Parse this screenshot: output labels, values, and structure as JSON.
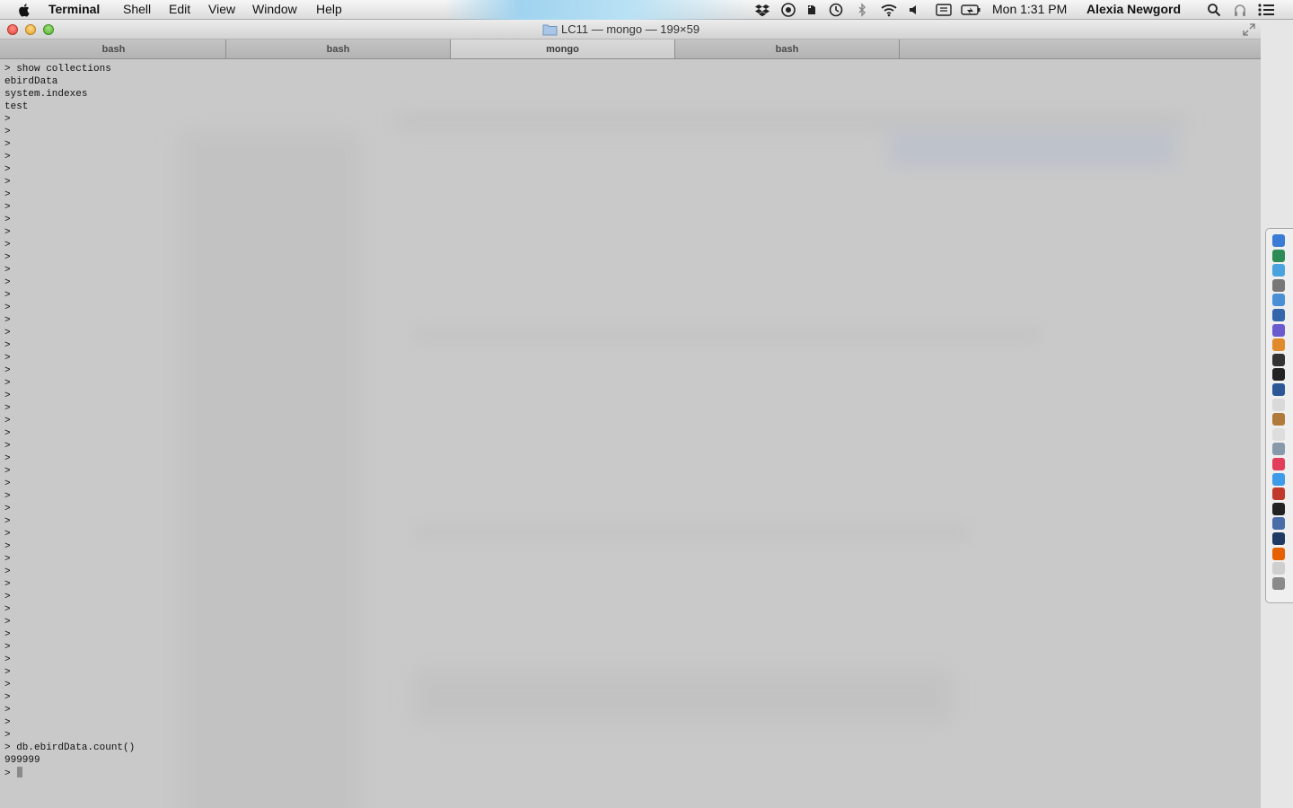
{
  "menubar": {
    "app_name": "Terminal",
    "items": [
      "Shell",
      "Edit",
      "View",
      "Window",
      "Help"
    ],
    "clock": "Mon 1:31 PM",
    "user": "Alexia Newgord",
    "status_icons": [
      "dropbox-icon",
      "sync-icon",
      "evernote-icon",
      "time-machine-icon",
      "bluetooth-icon",
      "wifi-icon",
      "volume-icon",
      "input-menu-icon",
      "battery-icon",
      "spotlight-icon",
      "notification-center-icon"
    ]
  },
  "window": {
    "title": "LC11 — mongo — 199×59",
    "tabs": [
      {
        "label": "bash",
        "active": false
      },
      {
        "label": "bash",
        "active": false
      },
      {
        "label": "mongo",
        "active": true
      },
      {
        "label": "bash",
        "active": false
      }
    ]
  },
  "terminal": {
    "lines": [
      "> show collections",
      "ebirdData",
      "system.indexes",
      "test",
      ">",
      ">",
      ">",
      ">",
      ">",
      ">",
      ">",
      ">",
      ">",
      ">",
      ">",
      ">",
      ">",
      ">",
      ">",
      ">",
      ">",
      ">",
      ">",
      ">",
      ">",
      ">",
      ">",
      ">",
      ">",
      ">",
      ">",
      ">",
      ">",
      ">",
      ">",
      ">",
      ">",
      ">",
      ">",
      ">",
      ">",
      ">",
      ">",
      ">",
      ">",
      ">",
      ">",
      ">",
      ">",
      ">",
      ">",
      ">",
      ">",
      ">",
      "> db.ebirdData.count()",
      "999999",
      "> "
    ]
  },
  "dock": {
    "icons": [
      "finder-icon",
      "launchpad-icon",
      "safari-icon",
      "system-preferences-icon",
      "mail-icon",
      "app-store-icon",
      "imovie-icon",
      "pages-icon",
      "photo-booth-icon",
      "terminal-icon",
      "word-icon",
      "chrome-icon",
      "contacts-icon",
      "calendar-icon",
      "preview-icon",
      "itunes-icon",
      "messages-icon",
      "skype-icon",
      "console-icon",
      "virtualbox-icon",
      "kindle-icon",
      "firefox-icon",
      "documents-icon",
      "trash-icon"
    ],
    "colors": [
      "#3a7bd5",
      "#2e8b57",
      "#4aa3df",
      "#777777",
      "#4a8fd6",
      "#3366aa",
      "#6a5acd",
      "#e08a2c",
      "#333333",
      "#222222",
      "#2b5797",
      "#d9d9d9",
      "#b07a3a",
      "#dddddd",
      "#8899aa",
      "#e23d5a",
      "#3d9be9",
      "#c0392b",
      "#222222",
      "#4a6da7",
      "#1f3a63",
      "#e66000",
      "#cfcfcf",
      "#8a8a8a"
    ]
  }
}
